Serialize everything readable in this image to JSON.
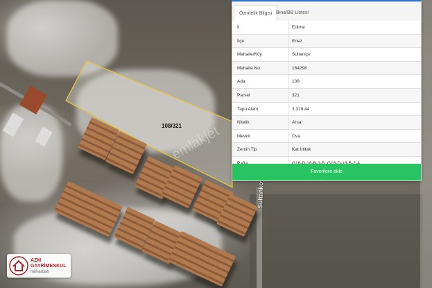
{
  "map": {
    "parcel_label": "108/321",
    "street_label": "Sultanköyü Yolu",
    "watermark": "emlakjet"
  },
  "panel": {
    "tabs": [
      {
        "label": "Öznitelik Bilgisi",
        "active": true
      },
      {
        "label": "Bina/BB Listesi",
        "active": false
      }
    ],
    "rows": [
      {
        "key": "İl",
        "value": "Edirne"
      },
      {
        "key": "İlçe",
        "value": "Enez"
      },
      {
        "key": "Mahalle/Köy",
        "value": "Sultaniçe"
      },
      {
        "key": "Mahalle No",
        "value": "164298"
      },
      {
        "key": "Ada",
        "value": "108"
      },
      {
        "key": "Parsel",
        "value": "321"
      },
      {
        "key": "Tapu Alanı",
        "value": "3.318,44"
      },
      {
        "key": "Nitelik",
        "value": "Arsa"
      },
      {
        "key": "Mevkii",
        "value": "Ova"
      },
      {
        "key": "Zemin Tip",
        "value": "Kat İrtifak"
      },
      {
        "key": "Pafta",
        "value": "G16-D-18-B-1-B, G16-D-18-B-2-A"
      }
    ],
    "favorite_button": "Favorilere ekle"
  },
  "logo": {
    "line1": "AZM",
    "line2": "GAYRİMENKUL",
    "line3": "mimardan"
  },
  "colors": {
    "accent_green": "#29c462",
    "parcel_outline": "#e8c23a",
    "logo_red": "#b3262d"
  }
}
